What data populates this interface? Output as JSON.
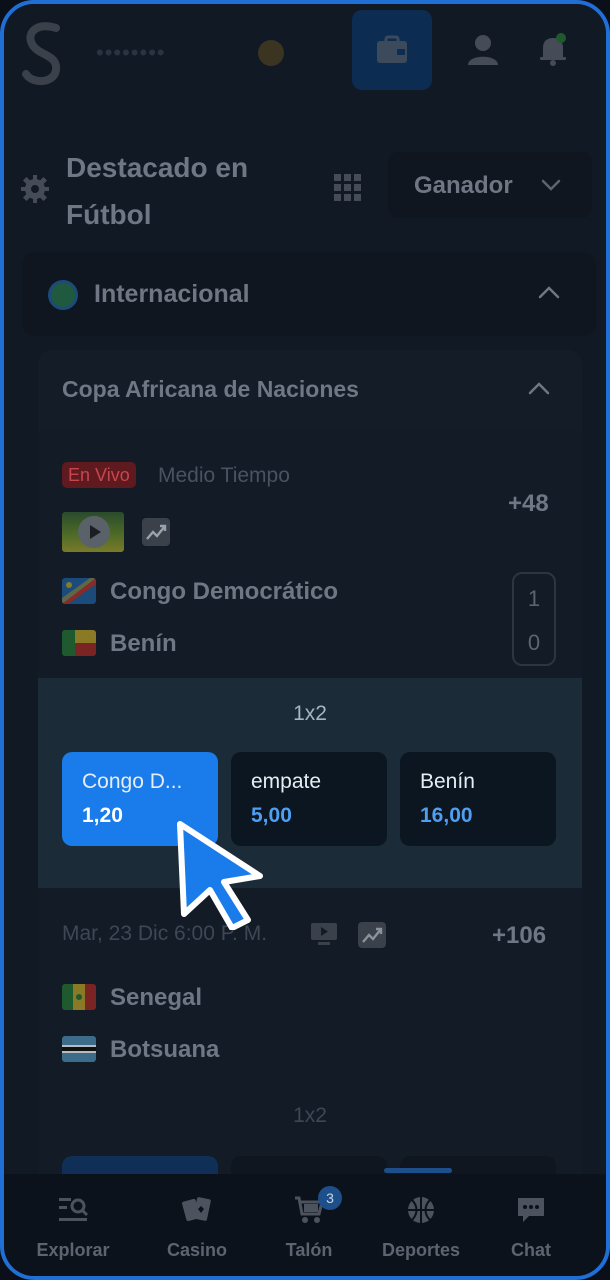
{
  "header": {
    "balance": "••••••••",
    "icons": [
      "logo-s",
      "coin-icon",
      "wallet-icon",
      "user-icon",
      "bell-icon"
    ]
  },
  "section": {
    "title": "Destacado en Fútbol",
    "market_selector": "Ganador"
  },
  "league": {
    "label": "Internacional"
  },
  "competition": {
    "label": "Copa Africana de Naciones"
  },
  "match1": {
    "live_label": "En Vivo",
    "period": "Medio Tiempo",
    "more_markets": "+48",
    "home": "Congo Democrático",
    "away": "Benín",
    "home_score": "1",
    "away_score": "0",
    "market_name": "1x2",
    "odds": [
      {
        "label": "Congo D...",
        "value": "1,20",
        "selected": true
      },
      {
        "label": "empate",
        "value": "5,00",
        "selected": false
      },
      {
        "label": "Benín",
        "value": "16,00",
        "selected": false
      }
    ]
  },
  "match2": {
    "datetime": "Mar, 23 Dic  6:00 P. M.",
    "more_markets": "+106",
    "home": "Senegal",
    "away": "Botsuana",
    "market_name": "1x2"
  },
  "bottom_nav": {
    "items": [
      {
        "label": "Explorar",
        "icon": "explore-icon"
      },
      {
        "label": "Casino",
        "icon": "cards-icon"
      },
      {
        "label": "Talón",
        "icon": "betslip-icon",
        "badge": "3"
      },
      {
        "label": "Deportes",
        "icon": "basketball-icon"
      },
      {
        "label": "Chat",
        "icon": "chat-icon"
      }
    ]
  },
  "colors": {
    "accent": "#1a7bea",
    "odds_value": "#4f9ef2",
    "live_badge": "#c6464e",
    "border": "#1f6fd6"
  }
}
